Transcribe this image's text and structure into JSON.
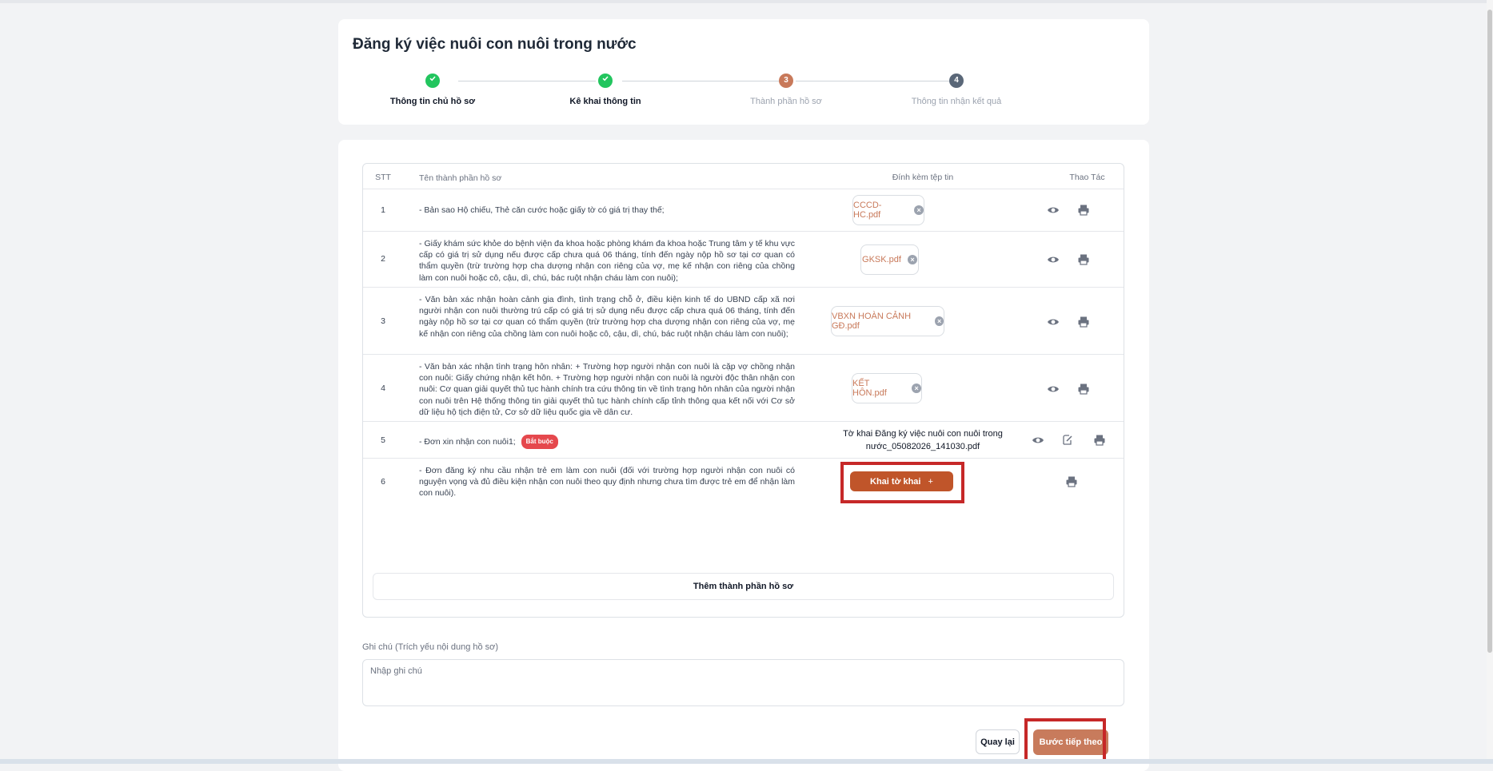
{
  "page": {
    "title": "Đăng ký việc nuôi con nuôi trong nước"
  },
  "stepper": {
    "steps": [
      {
        "number": "",
        "label": "Thông tin chủ hồ sơ",
        "status": "done"
      },
      {
        "number": "",
        "label": "Kê khai thông tin",
        "status": "done"
      },
      {
        "number": "3",
        "label": "Thành phần hồ sơ",
        "status": "active"
      },
      {
        "number": "4",
        "label": "Thông tin nhận kết quả",
        "status": "pending"
      }
    ]
  },
  "table": {
    "headers": {
      "stt": "STT",
      "name": "Tên thành phần hồ sơ",
      "attach": "Đính kèm tệp tin",
      "actions": "Thao Tác"
    },
    "rows": [
      {
        "stt": "1",
        "name": "- Bản sao Hộ chiếu, Thẻ căn cước hoặc giấy tờ có giá trị thay thế;",
        "file": "CCCD-HC.pdf"
      },
      {
        "stt": "2",
        "name": "- Giấy khám sức khỏe do bệnh viện đa khoa hoặc phòng khám đa khoa hoặc Trung tâm y tế khu vực cấp có giá trị sử dụng nếu được cấp chưa quá 06 tháng, tính đến ngày nộp hồ sơ tại cơ quan có thẩm quyền (trừ trường hợp cha dượng nhận con riêng của vợ, mẹ kế nhận con riêng của chồng làm con nuôi hoặc cô, cậu, dì, chú, bác ruột nhận cháu làm con nuôi);",
        "file": "GKSK.pdf"
      },
      {
        "stt": "3",
        "name": "- Văn bản xác nhận hoàn cảnh gia đình, tình trạng chỗ ở, điều kiện kinh tế do UBND cấp xã nơi người nhận con nuôi thường trú cấp có giá trị sử dụng nếu được cấp chưa quá 06 tháng, tính đến ngày nộp hồ sơ tại cơ quan có thẩm quyền (trừ trường hợp cha dượng nhận con riêng của vợ, mẹ kế nhận con riêng của chồng làm con nuôi hoặc cô, cậu, dì, chú, bác ruột nhận cháu làm con nuôi);",
        "file": "VBXN HOÀN CẢNH GĐ.pdf"
      },
      {
        "stt": "4",
        "name": "- Văn bản xác nhận tình trạng hôn nhân: + Trường hợp người nhận con nuôi là cặp vợ chồng nhận con nuôi: Giấy chứng nhận kết hôn. + Trường hợp người nhận con nuôi là người độc thân nhận con nuôi: Cơ quan giải quyết thủ tục hành chính tra cứu thông tin về tình trạng hôn nhân của người nhận con nuôi trên Hệ thống thông tin giải quyết thủ tục hành chính cấp tỉnh thông qua kết nối với Cơ sở dữ liệu hộ tịch điện tử, Cơ sở dữ liệu quốc gia về dân cư.",
        "file": "KẾT HÔN.pdf"
      },
      {
        "stt": "5",
        "name": "- Đơn xin nhận con nuôi1;",
        "badge": "Bắt buộc",
        "generated_file": "Tờ khai Đăng ký việc nuôi con nuôi trong nước_05082026_141030.pdf"
      },
      {
        "stt": "6",
        "name": "- Đơn đăng ký nhu cầu nhận trẻ em làm con nuôi (đối với trường hợp người nhận con nuôi có nguyện vọng và đủ điều kiện nhận con nuôi theo quy định nhưng chưa tìm được trẻ em để nhận làm con nuôi).",
        "button": "Khai tờ khai",
        "button_icon": "+"
      }
    ],
    "add_section": "Thêm thành phần hồ sơ"
  },
  "note": {
    "label": "Ghi chú (Trích yếu nội dung hồ sơ)",
    "placeholder": "Nhập ghi chú",
    "value": ""
  },
  "footer": {
    "back": "Quay lại",
    "next": "Bước tiếp theo"
  },
  "colors": {
    "accent": "#c0552a",
    "done": "#22c55e",
    "highlight": "#c62828",
    "required": "#e5484d"
  }
}
